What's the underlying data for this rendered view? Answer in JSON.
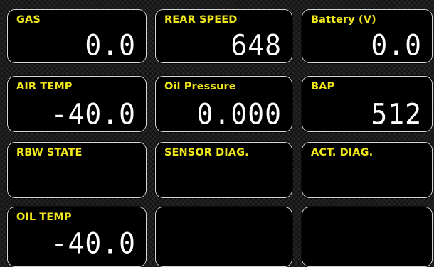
{
  "tiles": [
    {
      "label": "GAS",
      "value": "0.0"
    },
    {
      "label": "REAR SPEED",
      "value": "648"
    },
    {
      "label": "Battery (V)",
      "value": "0.0"
    },
    {
      "label": "AIR TEMP",
      "value": "-40.0"
    },
    {
      "label": "Oil Pressure",
      "value": "0.000"
    },
    {
      "label": "BAP",
      "value": "512"
    },
    {
      "label": "RBW STATE",
      "value": ""
    },
    {
      "label": "SENSOR DIAG.",
      "value": ""
    },
    {
      "label": "ACT. DIAG.",
      "value": ""
    },
    {
      "label": "OIL TEMP",
      "value": "-40.0"
    },
    {
      "label": "",
      "value": ""
    },
    {
      "label": "",
      "value": ""
    }
  ],
  "colors": {
    "label": "#f0e61a",
    "value": "#ffffff",
    "tile_background": "#000000",
    "tile_border": "#d6d6d6",
    "screen_background": "#1c1c1c"
  }
}
